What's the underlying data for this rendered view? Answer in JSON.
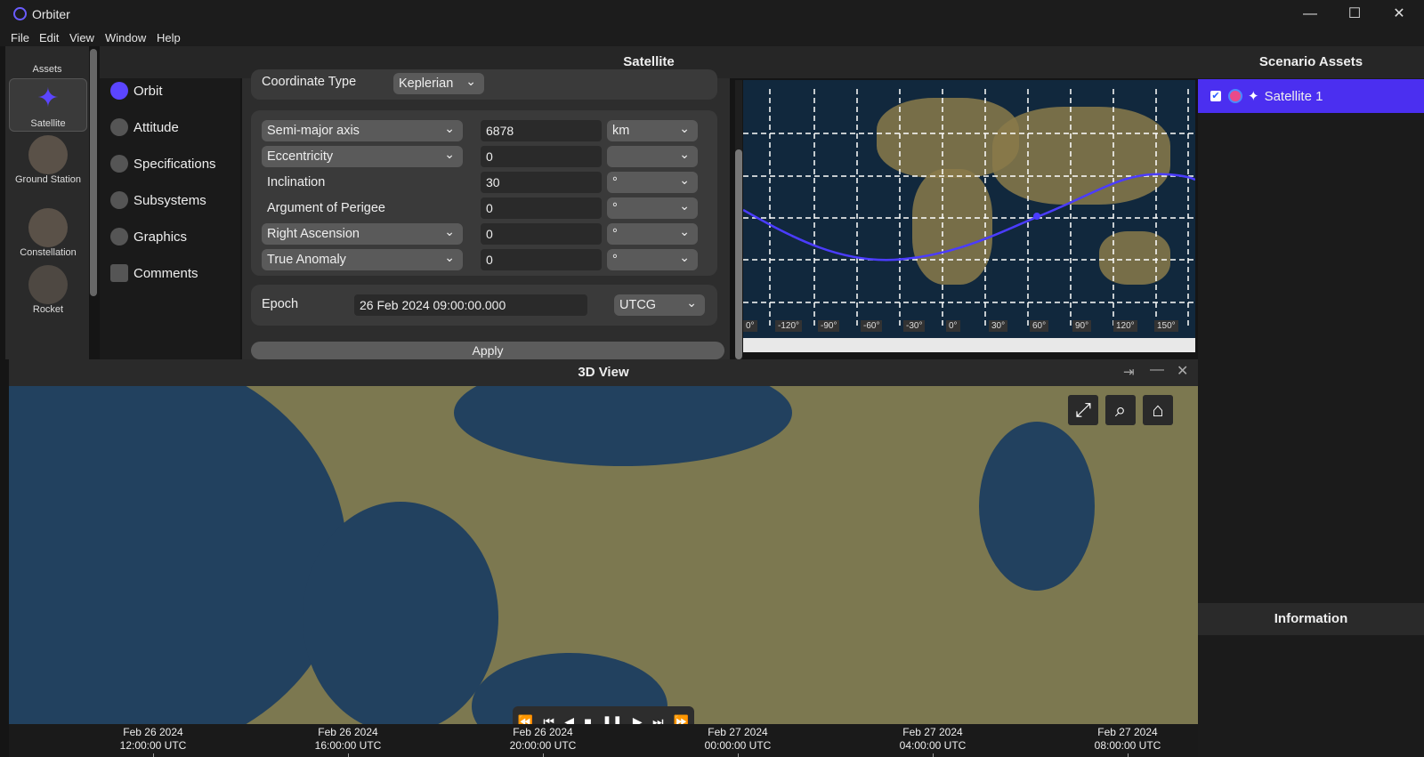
{
  "app": {
    "title": "Orbiter"
  },
  "window_controls": {
    "minimize": "—",
    "maximize": "☐",
    "close": "✕"
  },
  "menu": [
    "File",
    "Edit",
    "View",
    "Window",
    "Help"
  ],
  "assets": {
    "title": "Assets",
    "items": [
      {
        "label": "Satellite",
        "icon": "satellite-icon",
        "selected": true
      },
      {
        "label": "Ground Station",
        "icon": "ground-station-icon",
        "selected": false
      },
      {
        "label": "Constellation",
        "icon": "constellation-icon",
        "selected": false
      },
      {
        "label": "Rocket",
        "icon": "rocket-icon",
        "selected": false
      }
    ]
  },
  "satellite_panel": {
    "title": "Satellite",
    "nav": [
      "Orbit",
      "Attitude",
      "Specifications",
      "Subsystems",
      "Graphics",
      "Comments"
    ],
    "coordinate_type": {
      "label": "Coordinate Type",
      "value": "Keplerian"
    },
    "elements": [
      {
        "name": "Semi-major axis",
        "value": "6878",
        "unit": "km",
        "has_dropdown": true
      },
      {
        "name": "Eccentricity",
        "value": "0",
        "unit": "",
        "has_dropdown": true
      },
      {
        "name": "Inclination",
        "value": "30",
        "unit": "°",
        "has_dropdown": false
      },
      {
        "name": "Argument of Perigee",
        "value": "0",
        "unit": "°",
        "has_dropdown": false
      },
      {
        "name": "Right Ascension",
        "value": "0",
        "unit": "°",
        "has_dropdown": true
      },
      {
        "name": "True Anomaly",
        "value": "0",
        "unit": "°",
        "has_dropdown": true
      }
    ],
    "epoch": {
      "label": "Epoch",
      "value": "26 Feb 2024 09:00:00.000",
      "system": "UTCG"
    },
    "apply_label": "Apply"
  },
  "map": {
    "longitude_ticks": [
      "0°",
      "-120°",
      "-90°",
      "-60°",
      "-30°",
      "0°",
      "30°",
      "60°",
      "90°",
      "120°",
      "150°"
    ],
    "track_color": "#4b3cff"
  },
  "scenario_assets": {
    "title": "Scenario Assets",
    "items": [
      {
        "label": "Satellite 1",
        "checked": true,
        "color": "#e84a8a"
      }
    ]
  },
  "information": {
    "title": "Information"
  },
  "view3d": {
    "title": "3D View",
    "header_icons": [
      "pin-icon",
      "minimize-icon",
      "close-icon"
    ],
    "overlay_buttons": [
      "fullscreen-icon",
      "search-icon",
      "home-icon"
    ],
    "playback": [
      "⏪",
      "⏮",
      "◀",
      "■",
      "❚❚",
      "▶",
      "⏭",
      "⏩"
    ],
    "timeline": [
      {
        "date": "Feb 26 2024",
        "time": "12:00:00 UTC"
      },
      {
        "date": "Feb 26 2024",
        "time": "16:00:00 UTC"
      },
      {
        "date": "Feb 26 2024",
        "time": "20:00:00 UTC"
      },
      {
        "date": "Feb 27 2024",
        "time": "00:00:00 UTC"
      },
      {
        "date": "Feb 27 2024",
        "time": "04:00:00 UTC"
      },
      {
        "date": "Feb 27 2024",
        "time": "08:00:00 UTC"
      }
    ]
  }
}
